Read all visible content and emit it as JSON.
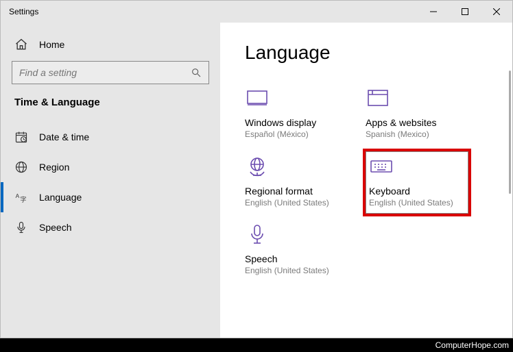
{
  "window": {
    "title": "Settings"
  },
  "home": {
    "label": "Home"
  },
  "search": {
    "placeholder": "Find a setting"
  },
  "section": {
    "label": "Time & Language"
  },
  "nav": [
    {
      "id": "date-time",
      "label": "Date & time",
      "active": false
    },
    {
      "id": "region",
      "label": "Region",
      "active": false
    },
    {
      "id": "language",
      "label": "Language",
      "active": true
    },
    {
      "id": "speech",
      "label": "Speech",
      "active": false
    }
  ],
  "page": {
    "title": "Language"
  },
  "tiles": [
    {
      "id": "windows-display",
      "title": "Windows display",
      "sub": "Español (México)"
    },
    {
      "id": "apps-websites",
      "title": "Apps & websites",
      "sub": "Spanish (Mexico)"
    },
    {
      "id": "regional-format",
      "title": "Regional format",
      "sub": "English (United States)"
    },
    {
      "id": "keyboard",
      "title": "Keyboard",
      "sub": "English (United States)",
      "selected": true
    },
    {
      "id": "speech",
      "title": "Speech",
      "sub": "English (United States)"
    }
  ],
  "footer": {
    "text": "ComputerHope.com"
  }
}
